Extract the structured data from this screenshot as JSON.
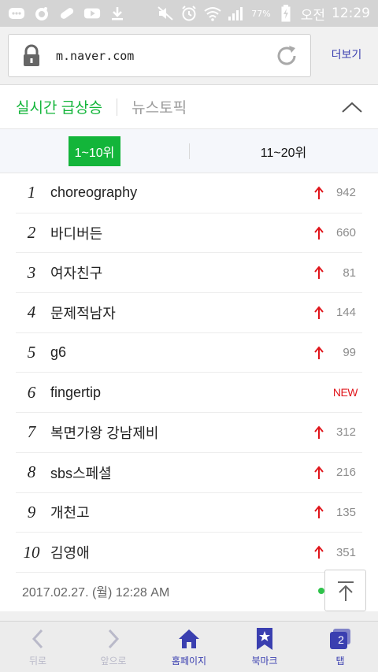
{
  "status_bar": {
    "battery": "77%",
    "ampm": "오전",
    "time": "12:29"
  },
  "address_bar": {
    "url": "m.naver.com",
    "more_label": "더보기"
  },
  "panel": {
    "tab_main": "실시간 급상승",
    "tab_sub": "뉴스토픽",
    "range_active": "1~10위",
    "range_inactive": "11~20위",
    "items": [
      {
        "rank": "1",
        "keyword": "choreography",
        "change": "942",
        "is_new": false
      },
      {
        "rank": "2",
        "keyword": "바디버든",
        "change": "660",
        "is_new": false
      },
      {
        "rank": "3",
        "keyword": "여자친구",
        "change": "81",
        "is_new": false
      },
      {
        "rank": "4",
        "keyword": "문제적남자",
        "change": "144",
        "is_new": false
      },
      {
        "rank": "5",
        "keyword": "g6",
        "change": "99",
        "is_new": false
      },
      {
        "rank": "6",
        "keyword": "fingertip",
        "change": "NEW",
        "is_new": true
      },
      {
        "rank": "7",
        "keyword": "복면가왕 강남제비",
        "change": "312",
        "is_new": false
      },
      {
        "rank": "8",
        "keyword": "sbs스페셜",
        "change": "216",
        "is_new": false
      },
      {
        "rank": "9",
        "keyword": "개천고",
        "change": "135",
        "is_new": false
      },
      {
        "rank": "10",
        "keyword": "김영애",
        "change": "351",
        "is_new": false
      }
    ],
    "timestamp": "2017.02.27. (월) 12:28 AM"
  },
  "bottom_bar": {
    "back": "뒤로",
    "forward": "앞으로",
    "home": "홈페이지",
    "bookmark": "북마크",
    "tabs": "탭",
    "tab_count": "2"
  },
  "colors": {
    "accent_green": "#13b53a",
    "up_arrow_red": "#e0151b",
    "nav_blue": "#3a3fb0"
  }
}
